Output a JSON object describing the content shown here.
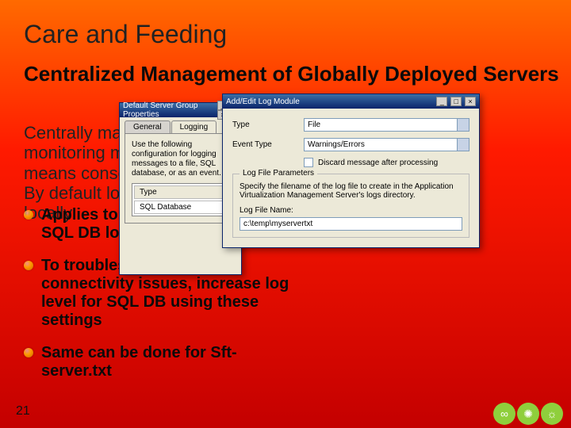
{
  "slide": {
    "title": "Care and Feeding",
    "subtitle": "Centralized Management of Globally Deployed Servers",
    "body": "Centrally managing and monitoring multiple server groups means consolidating all the logs. By default logs are generated locally",
    "bullets": [
      "Applies to Sft-server.txt as well as SQL DB logging",
      "To troubleshoot server connectivity issues, increase log level for SQL DB using these settings",
      "Same can be done for Sft-server.txt"
    ],
    "page_number": "21"
  },
  "win1": {
    "title": "Default Server Group Properties",
    "tabs": [
      "General",
      "Logging"
    ],
    "active_tab": "Logging",
    "intro": "Use the following configuration for logging messages to a file, SQL database, or as an event.",
    "table": {
      "header": "Type",
      "rows": [
        "SQL Database"
      ]
    }
  },
  "win2": {
    "title": "Add/Edit Log Module",
    "type_label": "Type",
    "type_value": "File",
    "event_label": "Event Type",
    "event_value": "Warnings/Errors",
    "discard_label": "Discard message after processing",
    "group_legend": "Log File Parameters",
    "group_help": "Specify the filename of the log file to create in the Application Virtualization Management Server's logs directory.",
    "file_label": "Log File Name:",
    "file_value": "c:\\temp\\myservertxt"
  }
}
